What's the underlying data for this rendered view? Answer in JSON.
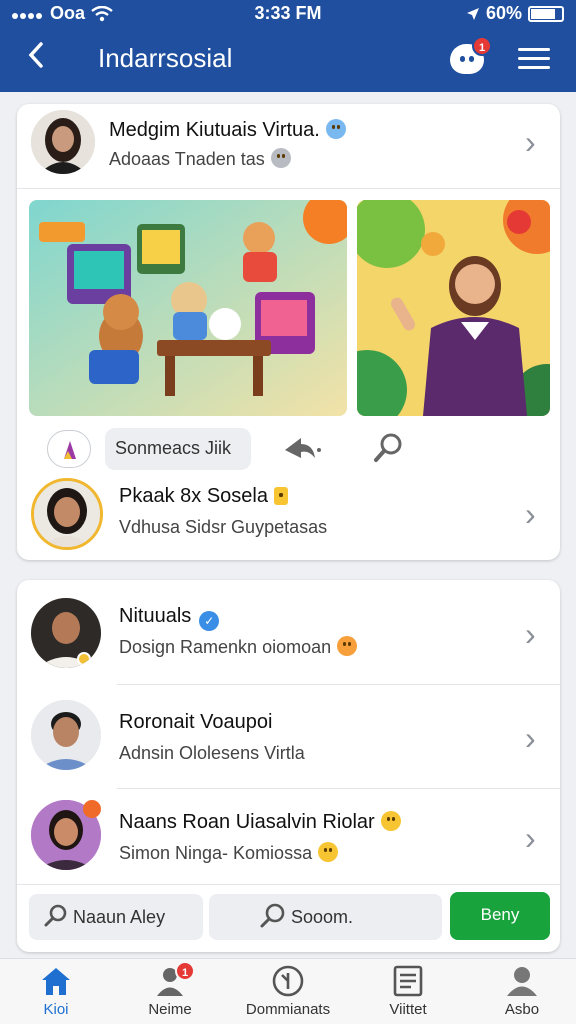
{
  "status_bar": {
    "carrier": "Ooa",
    "time": "3:33 FM",
    "battery": "60%"
  },
  "header": {
    "back_label": "‹",
    "title": "Indarrsosial",
    "notification_count": "1"
  },
  "card1": {
    "profile": {
      "name": "Medgim Kiutuais Virtua.",
      "subtitle": "Adoaas Tnaden tas"
    },
    "action_search": "Sonmeacs Jiik",
    "profile2": {
      "name": "Pkaak 8x Sosela",
      "subtitle": "Vdhusa Sidsr Guypetasas"
    }
  },
  "card2": {
    "items": [
      {
        "name": "Nituuals",
        "subtitle": "Dosign Ramenkn oiomoan"
      },
      {
        "name": "Roronait Voaupoi",
        "subtitle": "Adnsin Ololesens Virtla"
      },
      {
        "name": "Naans Roan Uiasalvin Riolar",
        "subtitle": "Simon Ninga- Komiossa"
      }
    ]
  },
  "bottom_actions": {
    "left": "Naaun Aley",
    "middle": "Sooom.",
    "primary": "Beny"
  },
  "tabs": [
    {
      "label": "Kioi",
      "active": true
    },
    {
      "label": "Neime",
      "badge": "1"
    },
    {
      "label": "Dommianats"
    },
    {
      "label": "Viittet"
    },
    {
      "label": "Asbo"
    }
  ],
  "colors": {
    "brand": "#1f4f9e",
    "primary_button": "#19a33d",
    "active_tab": "#1f6fd1"
  }
}
